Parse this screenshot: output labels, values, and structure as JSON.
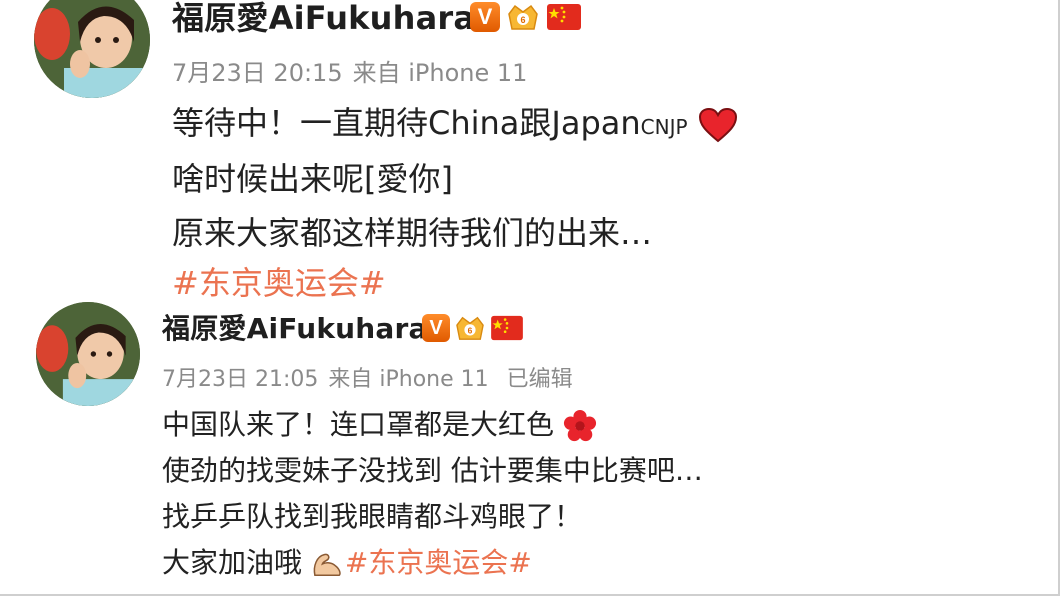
{
  "posts": [
    {
      "username": "福原愛AiFukuhara",
      "date": "7月23日 20:15",
      "source": "来自 iPhone 11",
      "edited": "",
      "lines": {
        "l1": "等待中！一直期待China跟Japan",
        "l1_small": "CNJP",
        "l2": "啥时候出来呢[愛你]",
        "l3": "原来大家都这样期待我们的出来…",
        "l4": "#东京奥运会#"
      }
    },
    {
      "username": "福原愛AiFukuhara",
      "date": "7月23日 21:05",
      "source": "来自 iPhone 11",
      "edited": "已编辑",
      "lines": {
        "l1": "中国队来了！连口罩都是大红色",
        "l2": "使劲的找雯妹子没找到 估计要集中比赛吧…",
        "l3": "找乒乒队找到我眼睛都斗鸡眼了！",
        "l4": "大家加油哦",
        "l4_tag": "#东京奥运会#"
      }
    }
  ],
  "icons": {
    "verified": "verified-v-icon",
    "level": "vip-level-icon",
    "flag": "china-flag-icon",
    "heart": "red-heart-emoji",
    "flower": "red-flower-emoji",
    "arm": "flexed-biceps-emoji"
  },
  "badge_v_text": "V",
  "colors": {
    "hashtag": "#eb7350",
    "meta": "#8a8a8a",
    "verified": "#ff7a14"
  }
}
